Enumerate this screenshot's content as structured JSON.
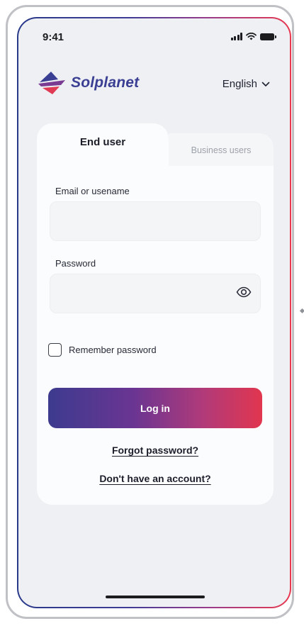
{
  "status_bar": {
    "time": "9:41",
    "icons": [
      "signal-icon",
      "wifi-icon",
      "battery-icon"
    ]
  },
  "header": {
    "brand_name": "Solplanet",
    "language": "English",
    "language_icon": "chevron-down-icon"
  },
  "tabs": [
    {
      "label": "End user",
      "active": true
    },
    {
      "label": "Business users",
      "active": false
    }
  ],
  "form": {
    "email_label": "Email or usename",
    "email_value": "",
    "password_label": "Password",
    "password_value": "",
    "password_toggle_icon": "eye-icon",
    "remember_label": "Remember password",
    "remember_checked": false,
    "login_label": "Log in",
    "forgot_label": "Forgot password?",
    "signup_label": "Don't have an account?"
  },
  "colors": {
    "brand": "#3a3f93",
    "accent_start": "#3d3b8f",
    "accent_end": "#e1364f",
    "background": "#eef0f3"
  }
}
